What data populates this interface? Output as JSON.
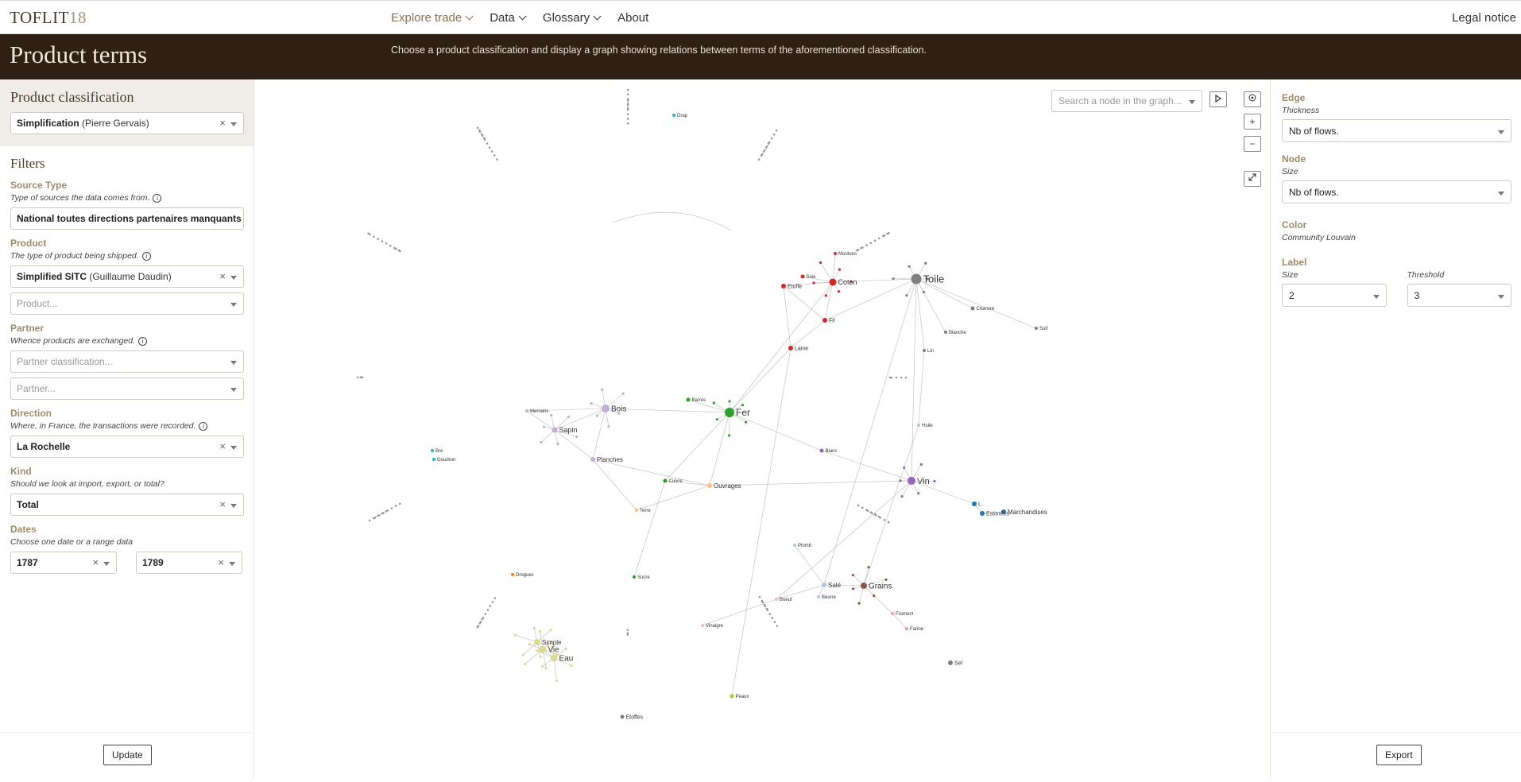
{
  "nav": {
    "logo_text": "TOFLIT",
    "logo_num": "18",
    "items": [
      {
        "label": "Explore trade",
        "dropdown": true,
        "active": true
      },
      {
        "label": "Data",
        "dropdown": true
      },
      {
        "label": "Glossary",
        "dropdown": true
      },
      {
        "label": "About",
        "dropdown": false
      }
    ],
    "legal": "Legal notice"
  },
  "header": {
    "title": "Product terms",
    "description": "Choose a product classification and display a graph showing relations between terms of the aforementioned classification."
  },
  "left": {
    "product_classification": {
      "title": "Product classification",
      "value_bold": "Simplification",
      "value_rest": " (Pierre Gervais)"
    },
    "filters_title": "Filters",
    "source_type": {
      "label": "Source Type",
      "help": "Type of sources the data comes from.",
      "value": "National toutes directions partenaires manquants"
    },
    "product": {
      "label": "Product",
      "help": "The type of product being shipped.",
      "classification_bold": "Simplified SITC",
      "classification_rest": " (Guillaume Daudin)",
      "placeholder": "Product..."
    },
    "partner": {
      "label": "Partner",
      "help": "Whence products are exchanged.",
      "classification_placeholder": "Partner classification...",
      "placeholder": "Partner..."
    },
    "direction": {
      "label": "Direction",
      "help": "Where, in France, the transactions were recorded.",
      "value": "La Rochelle"
    },
    "kind": {
      "label": "Kind",
      "help": "Should we look at import, export, or total?",
      "value": "Total"
    },
    "dates": {
      "label": "Dates",
      "help": "Choose one date or a range data",
      "from": "1787",
      "to": "1789"
    },
    "update_label": "Update"
  },
  "graph": {
    "search_placeholder": "Search a node in the graph...",
    "icons": [
      "play-icon",
      "locate-icon",
      "zoom-in-icon",
      "zoom-out-icon",
      "fullscreen-icon"
    ],
    "labels": {
      "toile": "Toile",
      "coton": "Coton",
      "fer": "Fer",
      "vin": "Vin",
      "bois": "Bois",
      "grains": "Grains",
      "eau": "Eau",
      "vie": "Vie",
      "simple": "Simple",
      "sapin": "Sapin",
      "planches": "Planches",
      "ouvrages": "Ouvrages",
      "etoffe": "Etoffe",
      "laine": "Laine",
      "fil": "Fil",
      "soie": "Soie",
      "moutons": "Moutons",
      "chanvre": "Chanvre",
      "blanche": "Blanche",
      "lin": "Lin",
      "sel": "Sel",
      "sale": "Salé",
      "boeuf": "Boeuf",
      "beurre": "Beurre",
      "farine": "Farine",
      "froment": "Froment",
      "marchandises": "Marchandises",
      "estimees": "Estimées",
      "l": "L",
      "blanc": "Blanc",
      "huile": "Huile",
      "plomb": "Plomb",
      "vinaigre": "Vinaigre",
      "peaux": "Peaux",
      "etoffes": "Etoffes",
      "drogues": "Drogues",
      "sucre": "Sucre",
      "terre": "Terre",
      "cuivre": "Cuivre",
      "barres": "Barres",
      "merrains": "Merrains",
      "bre": "Bre",
      "goudron": "Goudron",
      "suif": "Suif",
      "drap": "Drap"
    }
  },
  "right": {
    "edge": {
      "label": "Edge",
      "sub": "Thickness",
      "value": "Nb of flows."
    },
    "node": {
      "label": "Node",
      "sub": "Size",
      "value": "Nb of flows."
    },
    "color": {
      "label": "Color",
      "sub": "Community Louvain"
    },
    "label": {
      "label": "Label",
      "size_sub": "Size",
      "size_value": "2",
      "threshold_sub": "Threshold",
      "threshold_value": "3"
    },
    "export_label": "Export"
  },
  "colors": {
    "header_bg": "#2f2016",
    "accent": "#a08a6c",
    "red": "#d62728",
    "grey": "#7f7f7f",
    "green": "#2ca02c",
    "purple": "#9467bd",
    "lavender": "#c5b0d5",
    "orange": "#ff7f0e",
    "light_orange": "#ffbb78",
    "blue": "#1f77b4",
    "light_blue": "#aec7e8",
    "brown": "#8c564b",
    "pink": "#e377c2",
    "light_pink": "#f7b6d2",
    "olive": "#bcbd22",
    "khaki": "#dbdb8d",
    "cyan": "#17becf",
    "rose": "#ff9896"
  }
}
